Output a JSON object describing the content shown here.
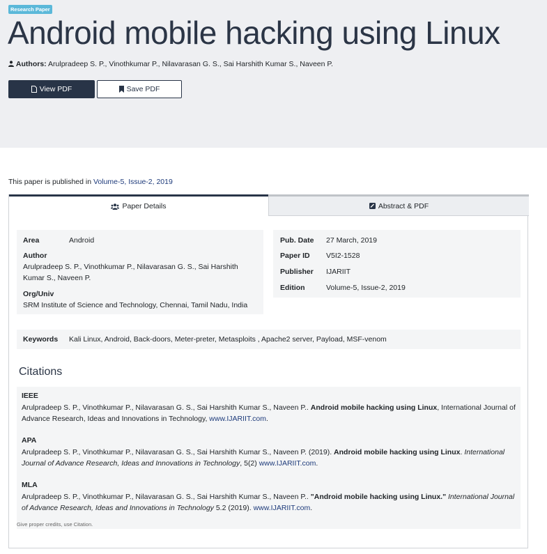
{
  "badge": "Research Paper",
  "title": "Android mobile hacking using Linux",
  "authors_label": "Authors:",
  "authors": "Arulpradeep S. P., Vinothkumar P., Nilavarasan G. S., Sai Harshith Kumar S., Naveen P.",
  "buttons": {
    "view_pdf": "View PDF",
    "save_pdf": "Save PDF"
  },
  "published_prefix": "This paper is published in",
  "published_link": "Volume-5, Issue-2, 2019",
  "tabs": {
    "details": "Paper Details",
    "abstract": "Abstract & PDF"
  },
  "details": {
    "area_label": "Area",
    "area": "Android",
    "author_label": "Author",
    "author": "Arulpradeep S. P., Vinothkumar P., Nilavarasan G. S., Sai Harshith Kumar S., Naveen P.",
    "org_label": "Org/Univ",
    "org": "SRM Institute of Science and Technology, Chennai, Tamil Nadu, India",
    "pubdate_label": "Pub. Date",
    "pubdate": "27 March, 2019",
    "paperid_label": "Paper ID",
    "paperid": "V5I2-1528",
    "publisher_label": "Publisher",
    "publisher": "IJARIIT",
    "edition_label": "Edition",
    "edition": "Volume-5, Issue-2, 2019"
  },
  "keywords_label": "Keywords",
  "keywords": "Kali Linux, Android, Back-doors, Meter-preter, Metasploits , Apache2 server, Payload, MSF-venom",
  "citations": {
    "heading": "Citations",
    "ieee_label": "IEEE",
    "ieee_authors": "Arulpradeep S. P., Vinothkumar P., Nilavarasan G. S., Sai Harshith Kumar S., Naveen P..",
    "ieee_title": "Android mobile hacking using Linux",
    "ieee_rest": ", International Journal of Advance Research, Ideas and Innovations in Technology,",
    "ieee_link": "www.IJARIIT.com",
    "apa_label": "APA",
    "apa_authors": "Arulpradeep S. P., Vinothkumar P., Nilavarasan G. S., Sai Harshith Kumar S., Naveen P. (2019).",
    "apa_title": "Android mobile hacking using Linux",
    "apa_journal": "International Journal of Advance Research, Ideas and Innovations in Technology",
    "apa_vol": ", 5(2)",
    "apa_link": "www.IJARIIT.com",
    "mla_label": "MLA",
    "mla_authors": "Arulpradeep S. P., Vinothkumar P., Nilavarasan G. S., Sai Harshith Kumar S., Naveen P..",
    "mla_title": "\"Android mobile hacking using Linux.\"",
    "mla_journal": "International Journal of Advance Research, Ideas and Innovations in Technology",
    "mla_vol": "5.2 (2019).",
    "mla_link": "www.IJARIIT.com",
    "credits": "Give proper credits, use Citation."
  },
  "icons": {
    "user": "user-icon",
    "file": "file-icon",
    "bookmark": "bookmark-icon",
    "users": "users-icon",
    "pdf": "pdf-icon"
  },
  "colors": {
    "primary": "#283447",
    "badge": "#5bb8d9",
    "link": "#1d3a7a",
    "hero_bg": "#eeeff2"
  }
}
